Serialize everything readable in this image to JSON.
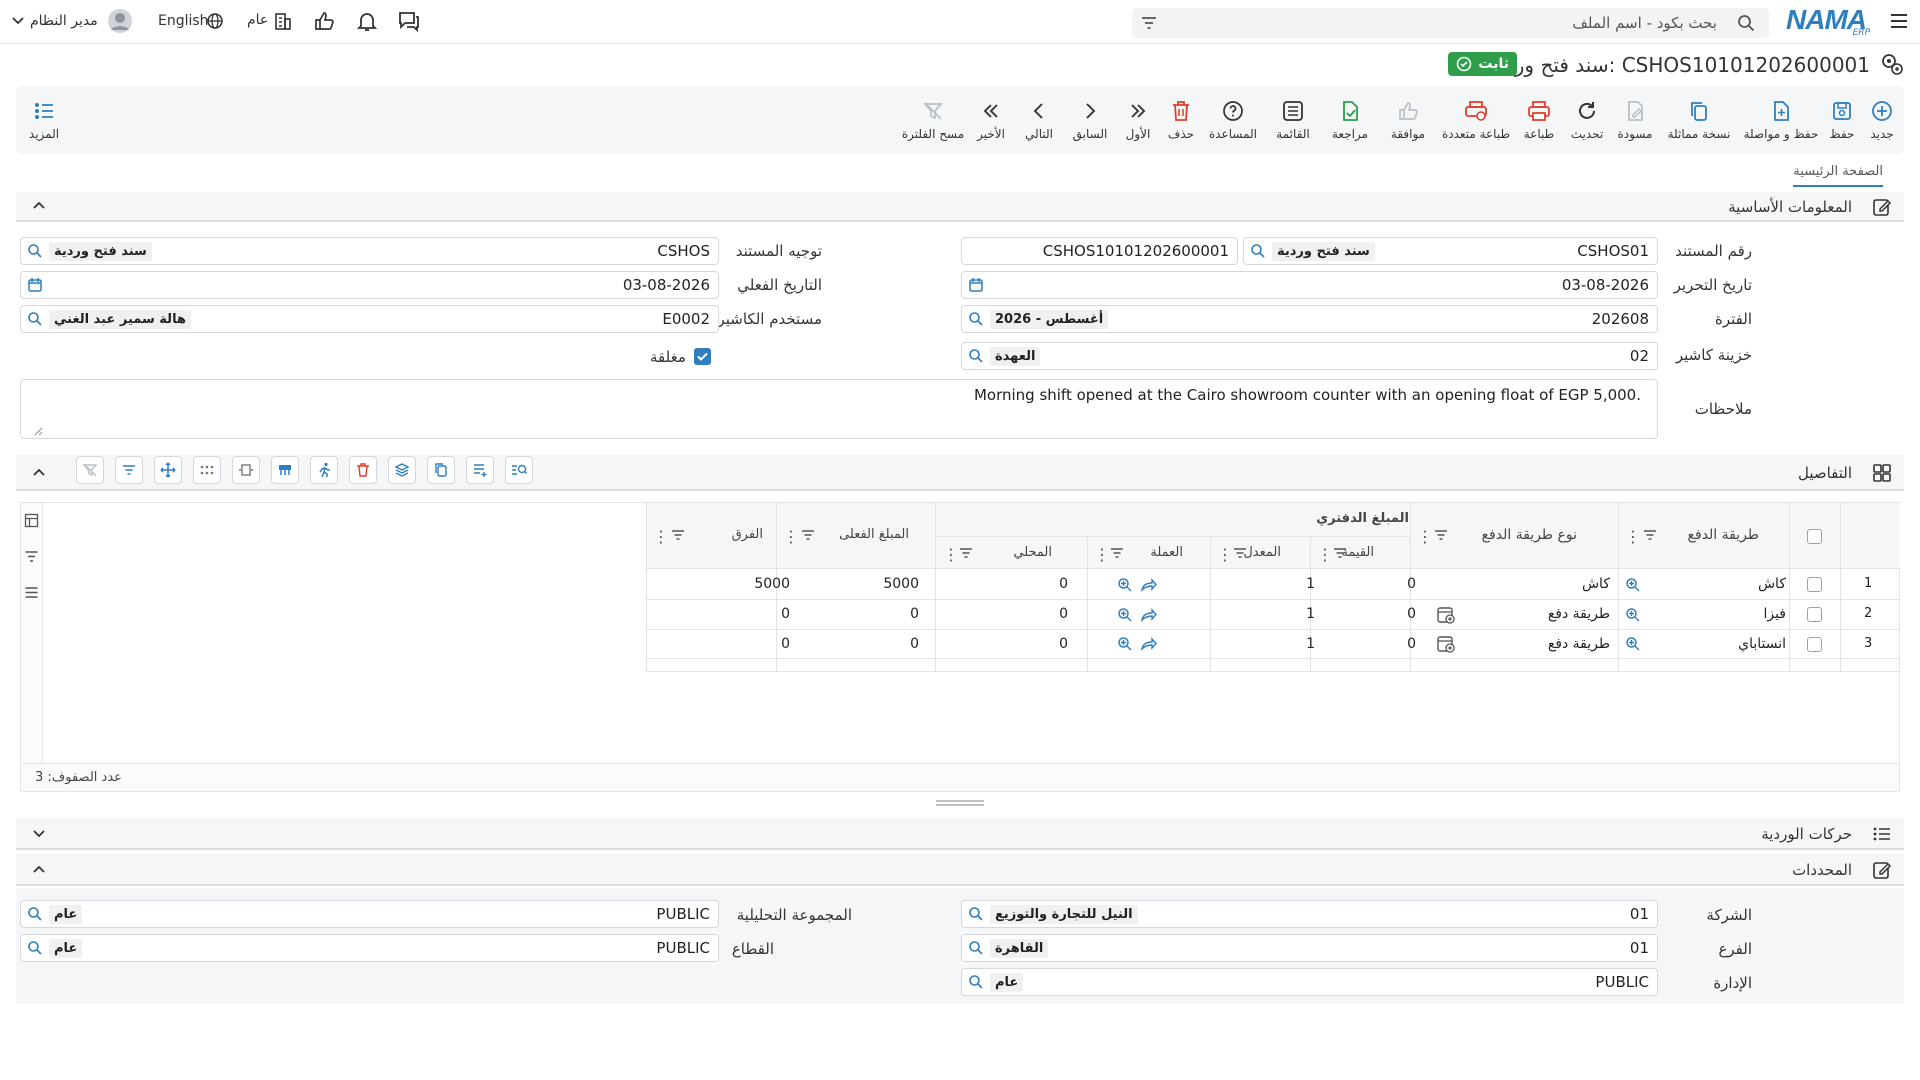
{
  "app": {
    "logo_main": "NAMA",
    "logo_sub": "ERP"
  },
  "header": {
    "search_placeholder": "بحث بكود - اسم الملف",
    "user_name": "مدير النظام",
    "language": "English",
    "scope": "عام"
  },
  "document": {
    "title": "سند فتح وردية: CSHOS10101202600001",
    "status": "ثابت"
  },
  "toolbar": {
    "new": "جديد",
    "save": "حفظ",
    "save_continue": "حفظ و مواصلة",
    "copy": "نسخة مماثلة",
    "draft": "مسودة",
    "refresh": "تحديث",
    "print": "طباعة",
    "multi_print": "طباعة متعددة",
    "approve": "موافقة",
    "review": "مراجعة",
    "list": "القائمة",
    "help": "المساعدة",
    "delete": "حذف",
    "first": "الأول",
    "previous": "السابق",
    "next": "التالي",
    "last": "الأخير",
    "clear_filter": "مسح الفلترة",
    "more": "المزيد"
  },
  "tabs": {
    "main": "الصفحة الرئيسية"
  },
  "sections": {
    "basic": "المعلومات الأساسية",
    "details": "التفاصيل",
    "shift_moves": "حركات الوردية",
    "dimensions": "المحددات"
  },
  "basic": {
    "doc_number_label": "رقم المستند",
    "doc_number_code": "CSHOS01",
    "doc_number_name": "سند فتح وردية",
    "doc_number_value": "CSHOS10101202600001",
    "doc_direction_label": "توجيه المستند",
    "doc_direction_code": "CSHOS",
    "doc_direction_name": "سند فتح وردية",
    "edit_date_label": "تاريخ التحرير",
    "edit_date": "03-08-2026",
    "actual_date_label": "التاريخ الفعلي",
    "actual_date": "03-08-2026",
    "period_label": "الفترة",
    "period_code": "202608",
    "period_name": "2026 - أغسطس",
    "cashier_user_label": "مستخدم الكاشير",
    "cashier_user_code": "E0002",
    "cashier_user_name": "هالة سمير عبد الغني",
    "cashier_box_label": "خزينة كاشير",
    "cashier_box_code": "02",
    "cashier_box_name": "العهدة",
    "closed_label": "مغلقة",
    "notes_label": "ملاحظات",
    "notes": "Morning shift opened at the Cairo showroom counter with an opening float of EGP 5,000."
  },
  "grid": {
    "headers": {
      "payment_method": "طريقة الدفع",
      "payment_type": "نوع طريقة الدفع",
      "book_amount": "المبلغ الدفتري",
      "value": "القيمة",
      "rate": "المعدل",
      "currency": "العملة",
      "local": "المحلي",
      "actual_amount": "المبلغ الفعلى",
      "difference": "الفرق"
    },
    "rows": [
      {
        "n": "1",
        "method": "كاش",
        "type": "كاش",
        "value": "0",
        "rate": "1",
        "local": "0",
        "actual": "5000",
        "diff": "5000"
      },
      {
        "n": "2",
        "method": "فيزا",
        "type": "طريقة دفع",
        "value": "0",
        "rate": "1",
        "local": "0",
        "actual": "0",
        "diff": "0"
      },
      {
        "n": "3",
        "method": "انستاباي",
        "type": "طريقة دفع",
        "value": "0",
        "rate": "1",
        "local": "0",
        "actual": "0",
        "diff": "0"
      }
    ],
    "row_count": "عدد الصفوف: 3"
  },
  "dimensions": {
    "company_label": "الشركة",
    "company_code": "01",
    "company_name": "النيل للتجارة والتوزيع",
    "analytic_label": "المجموعة التحليلية",
    "analytic_code": "PUBLIC",
    "analytic_name": "عام",
    "branch_label": "الفرع",
    "branch_code": "01",
    "branch_name": "القاهرة",
    "sector_label": "القطاع",
    "sector_code": "PUBLIC",
    "sector_name": "عام",
    "department_label": "الإدارة",
    "department_code": "PUBLIC",
    "department_name": "عام"
  },
  "colors": {
    "accent": "#2e7fc0",
    "status": "#2e9e4a",
    "danger": "#e0402b",
    "toolbar_bg": "#f4f6f8"
  }
}
